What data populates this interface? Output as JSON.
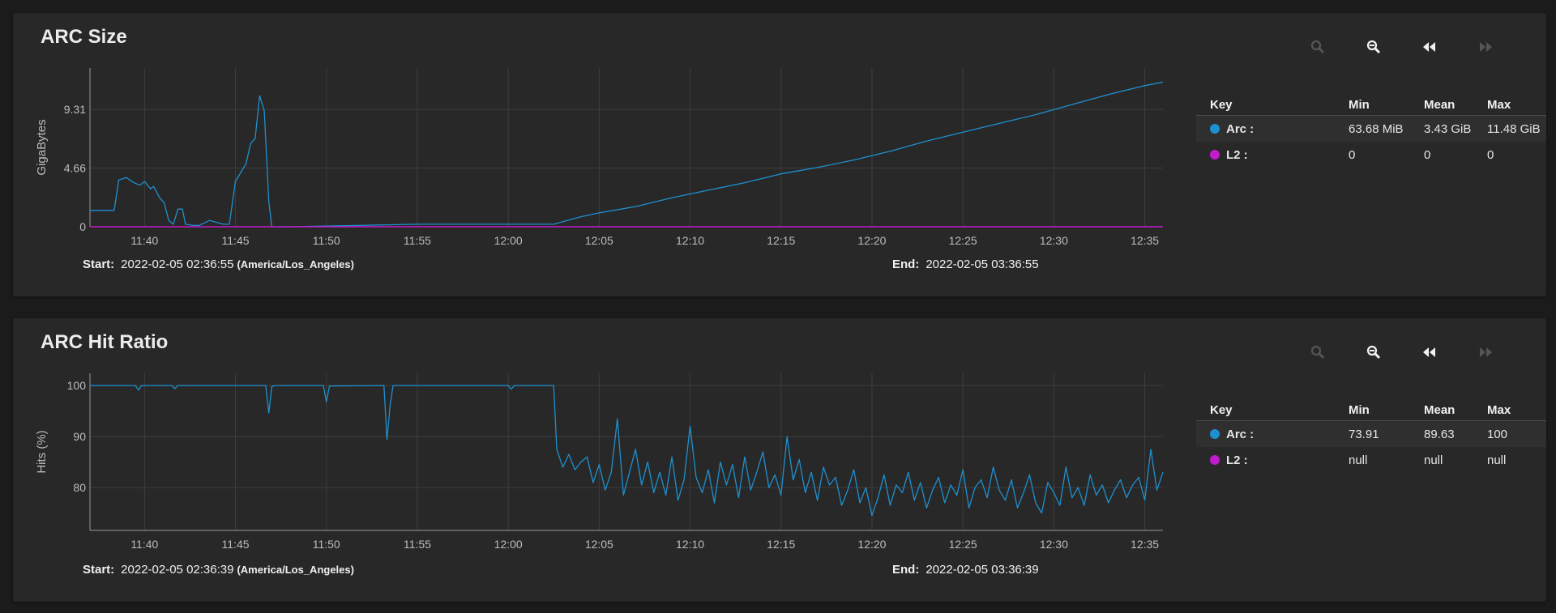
{
  "colors": {
    "arc": "#1e90d0",
    "l2": "#c21bcb"
  },
  "legend_headers": {
    "key": "Key",
    "min": "Min",
    "mean": "Mean",
    "max": "Max"
  },
  "cards": [
    {
      "title": "ARC Size",
      "start_label": "Start:",
      "start_value": "2022-02-05 02:36:55",
      "timezone": "(America/Los_Angeles)",
      "end_label": "End:",
      "end_value": "2022-02-05 03:36:55",
      "legend": [
        {
          "name": "Arc :",
          "min": "63.68 MiB",
          "mean": "3.43 GiB",
          "max": "11.48 GiB"
        },
        {
          "name": "L2 :",
          "min": "0",
          "mean": "0",
          "max": "0"
        }
      ]
    },
    {
      "title": "ARC Hit Ratio",
      "start_label": "Start:",
      "start_value": "2022-02-05 02:36:39",
      "timezone": "(America/Los_Angeles)",
      "end_label": "End:",
      "end_value": "2022-02-05 03:36:39",
      "legend": [
        {
          "name": "Arc :",
          "min": "73.91",
          "mean": "89.63",
          "max": "100"
        },
        {
          "name": "L2 :",
          "min": "null",
          "mean": "null",
          "max": "null"
        }
      ]
    }
  ],
  "chart_data": [
    {
      "type": "line",
      "title": "ARC Size",
      "xlabel": "",
      "ylabel": "GigaBytes",
      "x_range": [
        "11:37",
        "12:36"
      ],
      "ylim": [
        0,
        12.6
      ],
      "yticks": [
        0,
        4.66,
        9.31
      ],
      "ytick_labels": [
        "0",
        "4.66",
        "9.31"
      ],
      "xticks": [
        "11:40",
        "11:45",
        "11:50",
        "11:55",
        "12:00",
        "12:05",
        "12:10",
        "12:15",
        "12:20",
        "12:25",
        "12:30",
        "12:35"
      ],
      "grid": true,
      "series": [
        {
          "name": "Arc",
          "x": [
            "11:37:00",
            "11:38:20",
            "11:38:35",
            "11:39:00",
            "11:39:25",
            "11:39:45",
            "11:40:00",
            "11:40:20",
            "11:40:30",
            "11:40:50",
            "11:41:05",
            "11:41:20",
            "11:41:35",
            "11:41:50",
            "11:42:05",
            "11:42:15",
            "11:42:40",
            "11:43:00",
            "11:43:35",
            "11:44:20",
            "11:44:40",
            "11:45:00",
            "11:45:35",
            "11:45:50",
            "11:46:05",
            "11:46:20",
            "11:46:35",
            "11:46:50",
            "11:47:00",
            "11:47:10",
            "11:47:25",
            "11:48:00",
            "11:50:00",
            "11:55:00",
            "12:00:00",
            "12:02:30",
            "12:04:00",
            "12:05:00",
            "12:07:00",
            "12:09:00",
            "12:11:00",
            "12:13:00",
            "12:15:00",
            "12:17:00",
            "12:19:00",
            "12:21:00",
            "12:23:00",
            "12:25:00",
            "12:27:00",
            "12:29:00",
            "12:31:00",
            "12:33:00",
            "12:35:00",
            "12:36:00"
          ],
          "values": [
            1.3,
            1.3,
            3.7,
            3.9,
            3.5,
            3.3,
            3.6,
            3.0,
            3.2,
            2.3,
            1.9,
            0.5,
            0.2,
            1.4,
            1.4,
            0.2,
            0.1,
            0.1,
            0.5,
            0.2,
            0.2,
            3.6,
            5.0,
            6.6,
            7.0,
            10.4,
            9.2,
            2.0,
            0.0,
            0.0,
            0.0,
            0.0,
            0.05,
            0.2,
            0.2,
            0.2,
            0.8,
            1.1,
            1.6,
            2.3,
            2.9,
            3.5,
            4.2,
            4.7,
            5.3,
            6.0,
            6.8,
            7.5,
            8.2,
            8.9,
            9.7,
            10.5,
            11.2,
            11.48
          ]
        },
        {
          "name": "L2",
          "x": [
            "11:37:00",
            "12:36:00"
          ],
          "values": [
            0,
            0
          ]
        }
      ]
    },
    {
      "type": "line",
      "title": "ARC Hit Ratio",
      "xlabel": "",
      "ylabel": "Hits (%)",
      "x_range": [
        "11:37",
        "12:36"
      ],
      "ylim": [
        71.6,
        102.4
      ],
      "yticks": [
        80,
        90,
        100
      ],
      "ytick_labels": [
        "80",
        "90",
        "100"
      ],
      "xticks": [
        "11:40",
        "11:45",
        "11:50",
        "11:55",
        "12:00",
        "12:05",
        "12:10",
        "12:15",
        "12:20",
        "12:25",
        "12:30",
        "12:35"
      ],
      "grid": true,
      "series": [
        {
          "name": "Arc",
          "x": [
            "11:37:00",
            "11:39:30",
            "11:39:40",
            "11:39:50",
            "11:41:30",
            "11:41:40",
            "11:41:50",
            "11:46:40",
            "11:46:50",
            "11:47:00",
            "11:47:10",
            "11:49:50",
            "11:50:00",
            "11:50:10",
            "11:53:10",
            "11:53:20",
            "11:53:30",
            "11:53:40",
            "12:00:00",
            "12:00:10",
            "12:00:20",
            "12:02:30",
            "12:02:40",
            "12:03:00",
            "12:03:20",
            "12:03:40",
            "12:04:00",
            "12:04:20",
            "12:04:40",
            "12:05:00",
            "12:05:20",
            "12:05:40",
            "12:06:00",
            "12:06:20",
            "12:06:40",
            "12:07:00",
            "12:07:20",
            "12:07:40",
            "12:08:00",
            "12:08:20",
            "12:08:40",
            "12:09:00",
            "12:09:20",
            "12:09:40",
            "12:10:00",
            "12:10:20",
            "12:10:40",
            "12:11:00",
            "12:11:20",
            "12:11:40",
            "12:12:00",
            "12:12:20",
            "12:12:40",
            "12:13:00",
            "12:13:20",
            "12:13:40",
            "12:14:00",
            "12:14:20",
            "12:14:40",
            "12:15:00",
            "12:15:20",
            "12:15:40",
            "12:16:00",
            "12:16:20",
            "12:16:40",
            "12:17:00",
            "12:17:20",
            "12:17:40",
            "12:18:00",
            "12:18:20",
            "12:18:40",
            "12:19:00",
            "12:19:20",
            "12:19:40",
            "12:20:00",
            "12:20:20",
            "12:20:40",
            "12:21:00",
            "12:21:20",
            "12:21:40",
            "12:22:00",
            "12:22:20",
            "12:22:40",
            "12:23:00",
            "12:23:20",
            "12:23:40",
            "12:24:00",
            "12:24:20",
            "12:24:40",
            "12:25:00",
            "12:25:20",
            "12:25:40",
            "12:26:00",
            "12:26:20",
            "12:26:40",
            "12:27:00",
            "12:27:20",
            "12:27:40",
            "12:28:00",
            "12:28:20",
            "12:28:40",
            "12:29:00",
            "12:29:20",
            "12:29:40",
            "12:30:00",
            "12:30:20",
            "12:30:40",
            "12:31:00",
            "12:31:20",
            "12:31:40",
            "12:32:00",
            "12:32:20",
            "12:32:40",
            "12:33:00",
            "12:33:20",
            "12:33:40",
            "12:34:00",
            "12:34:20",
            "12:34:40",
            "12:35:00",
            "12:35:20",
            "12:35:40",
            "12:36:00"
          ],
          "values": [
            100,
            100,
            99.1,
            100,
            100,
            99.4,
            100,
            100,
            94.6,
            99.8,
            100,
            100,
            96.8,
            99.9,
            100,
            89.4,
            96.0,
            100,
            100,
            99.3,
            100,
            100,
            87.5,
            84.0,
            86.5,
            83.5,
            85.0,
            86.0,
            81.0,
            84.5,
            79.5,
            83.0,
            93.5,
            78.5,
            83.0,
            87.5,
            80.5,
            85.0,
            79.0,
            83.0,
            78.5,
            86.0,
            77.5,
            81.5,
            92.0,
            82.0,
            79.0,
            83.5,
            77.0,
            85.0,
            80.5,
            84.5,
            78.0,
            86.0,
            79.5,
            83.0,
            87.0,
            80.0,
            82.5,
            78.5,
            90.0,
            81.5,
            85.5,
            79.0,
            83.0,
            77.5,
            84.0,
            80.5,
            82.0,
            76.5,
            79.5,
            83.5,
            77.0,
            80.0,
            74.5,
            78.0,
            82.5,
            76.5,
            80.5,
            79.0,
            83.0,
            77.5,
            81.0,
            76.0,
            79.5,
            82.0,
            77.0,
            80.5,
            78.5,
            83.5,
            76.0,
            80.0,
            81.5,
            78.0,
            84.0,
            79.5,
            77.5,
            81.5,
            76.0,
            79.0,
            82.5,
            77.0,
            75.0,
            81.0,
            79.0,
            76.5,
            84.0,
            78.0,
            80.0,
            76.5,
            82.5,
            78.5,
            80.5,
            77.0,
            79.5,
            81.5,
            78.0,
            80.5,
            82.0,
            77.5,
            87.5,
            79.5,
            83.0
          ]
        },
        {
          "name": "L2",
          "x": [],
          "values": []
        }
      ]
    }
  ]
}
